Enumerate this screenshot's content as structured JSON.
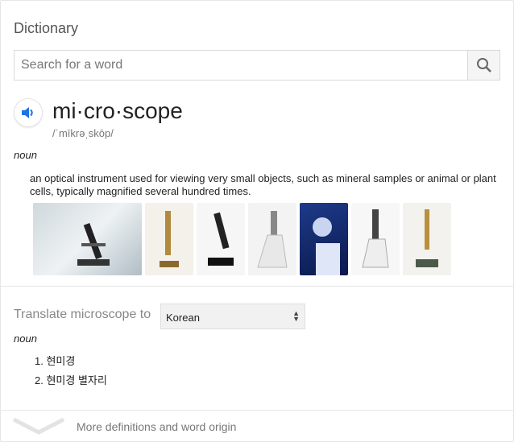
{
  "card_title": "Dictionary",
  "search": {
    "placeholder": "Search for a word",
    "value": ""
  },
  "entry": {
    "word": "mi·cro·scope",
    "phonetic": "/ˈmīkrəˌskōp/",
    "part_of_speech": "noun",
    "definition": "an optical instrument used for viewing very small objects, such as mineral samples or animal or plant cells, typically magnified several hundred times."
  },
  "translate": {
    "label": "Translate microscope to",
    "language": "Korean",
    "part_of_speech": "noun",
    "items": [
      "1. 현미경",
      "2. 현미경 별자리"
    ]
  },
  "more_label": "More definitions and word origin",
  "colors": {
    "accent": "#1a73e8",
    "separator": "#e6e6e6"
  }
}
